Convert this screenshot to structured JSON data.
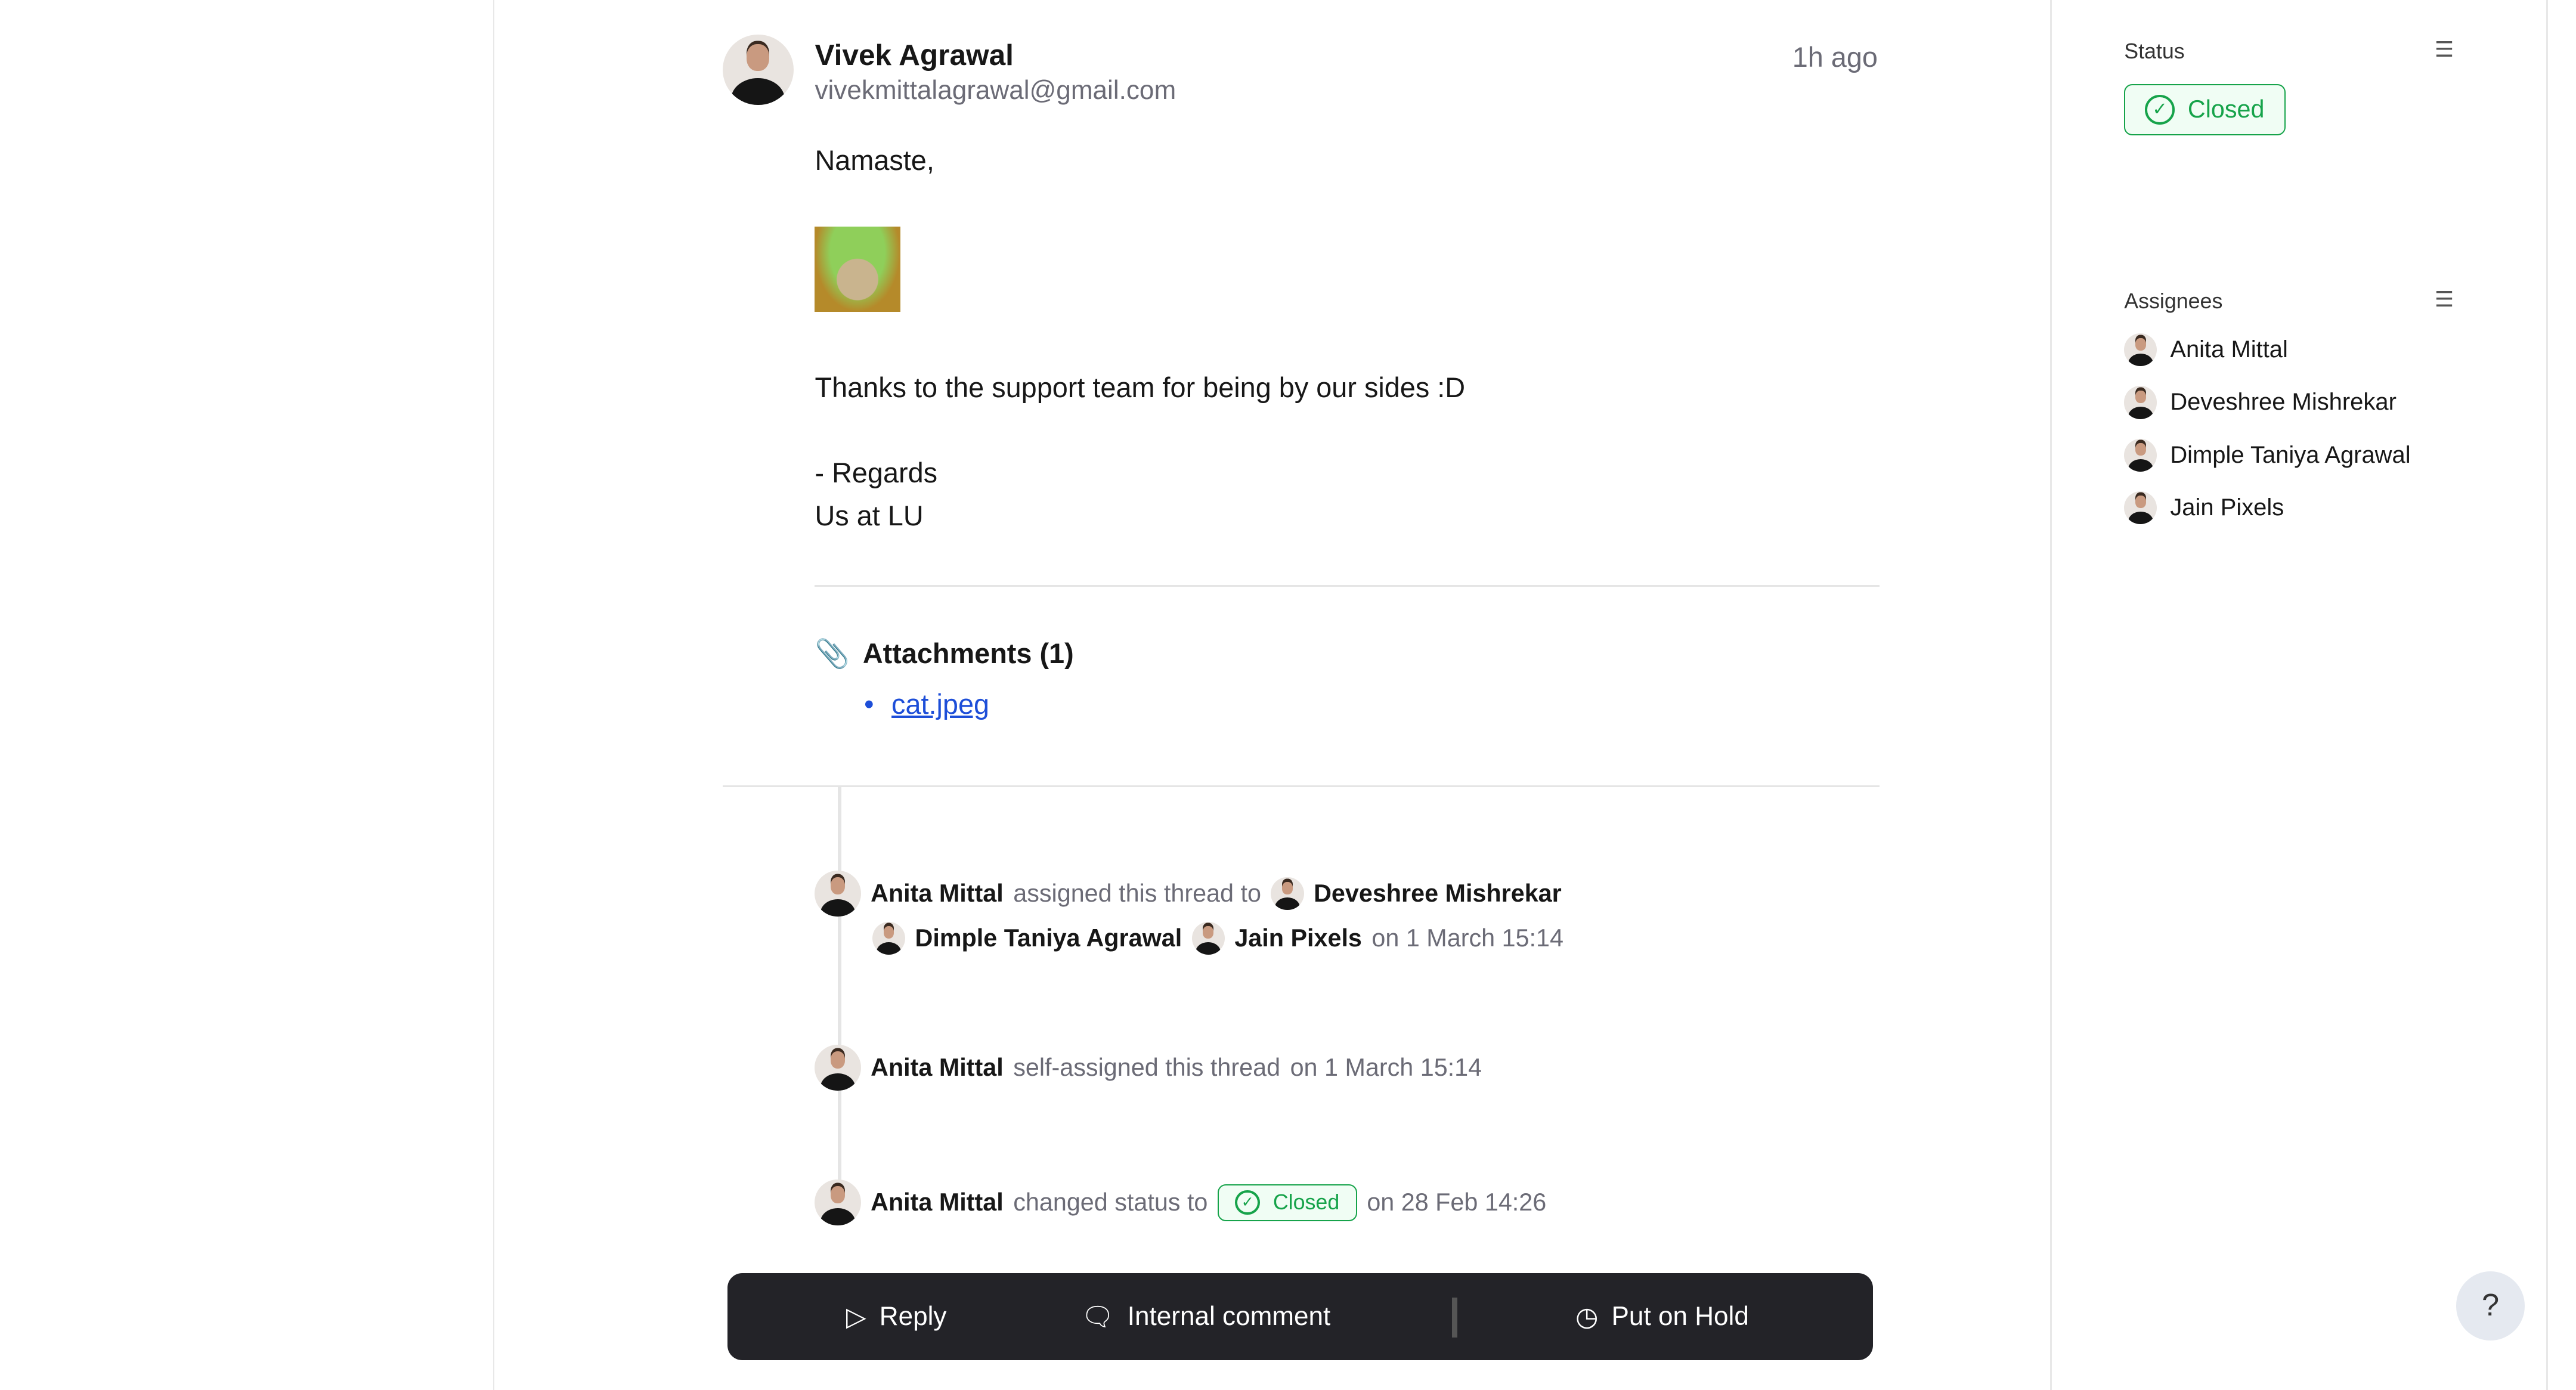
{
  "message": {
    "sender": "Vivek Agrawal",
    "email": "vivekmittalagrawal@gmail.com",
    "time": "1h ago",
    "greeting": "Namaste,",
    "body": "Thanks to the support team for being by our sides :D",
    "sign1": "- Regards",
    "sign2": "Us at LU"
  },
  "attachments": {
    "title": "Attachments (1)",
    "files": [
      "cat.jpeg"
    ]
  },
  "timeline": [
    {
      "actor": "Anita Mittal",
      "action": "assigned this thread to",
      "targets": [
        "Deveshree Mishrekar",
        "Dimple Taniya Agrawal",
        "Jain Pixels"
      ],
      "when": "on 1 March 15:14"
    },
    {
      "actor": "Anita Mittal",
      "action": "self-assigned this thread",
      "when": "on 1 March 15:14"
    },
    {
      "actor": "Anita Mittal",
      "action": "changed status to",
      "status": "Closed",
      "when": "on 28 Feb 14:26"
    }
  ],
  "actions": {
    "reply": "Reply",
    "comment": "Internal comment",
    "hold": "Put on Hold"
  },
  "sidebar": {
    "status_label": "Status",
    "status": "Closed",
    "assignees_label": "Assignees",
    "assignees": [
      "Anita Mittal",
      "Deveshree Mishrekar",
      "Dimple Taniya Agrawal",
      "Jain Pixels"
    ]
  },
  "help": "?",
  "colors": {
    "closed": "#16a34a",
    "bar": "#232328",
    "link": "#1d4ed8"
  }
}
